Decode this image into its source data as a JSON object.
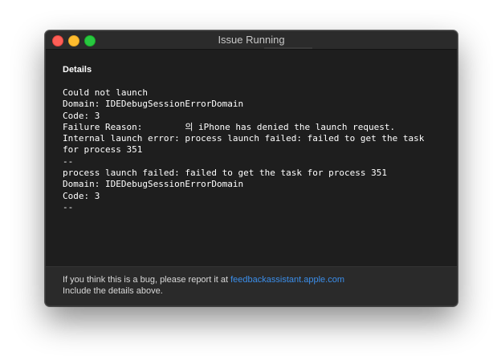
{
  "window": {
    "title": "Issue Running"
  },
  "details": {
    "heading": "Details",
    "lines": [
      "Could not launch",
      "Domain: IDEDebugSessionErrorDomain",
      "Code: 3",
      "Failure Reason:        의 iPhone has denied the launch request.",
      "Internal launch error: process launch failed: failed to get the task",
      "for process 351",
      "--",
      "process launch failed: failed to get the task for process 351",
      "Domain: IDEDebugSessionErrorDomain",
      "Code: 3",
      "--"
    ]
  },
  "footer": {
    "report_prefix": "If you think this is a bug, please report it at ",
    "report_link": "feedbackassistant.apple.com",
    "include_text": "Include the details above."
  },
  "colors": {
    "window_bg": "#1e1e1e",
    "footer_bg": "#2a2a2a",
    "link": "#3b8eea",
    "close": "#fe5f57",
    "minimize": "#febc2e",
    "zoom": "#28c840"
  }
}
